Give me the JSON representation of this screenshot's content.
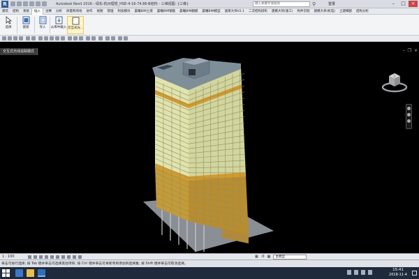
{
  "titlebar": {
    "app_logo": "R",
    "title": "Autodesk Revit 2016 - 绿东-杭州理想_HSE-4-16-74.86-B结构 - 三维视图: {三维}",
    "search_placeholder": "键入关键字或短语",
    "user": "登录"
  },
  "menu_tabs": [
    "建筑",
    "结构",
    "系统",
    "插入",
    "注释",
    "分析",
    "体量和场地",
    "协作",
    "视图",
    "管理",
    "附加模块",
    "晨曦BIM土建",
    "晨曦BIM钢筋",
    "晨曦BIM翻模",
    "晨曦BIM模型",
    "族库大师V2.1",
    "二次结构排布",
    "建模大师(施工)",
    "构件识别",
    "建模大师(机电)",
    "土建细部",
    "结构分析"
  ],
  "ribbon": {
    "buttons": [
      {
        "label": "选择"
      },
      {
        "label": "链接"
      },
      {
        "label": "导入"
      },
      {
        "label": "从库中载入"
      },
      {
        "label": "交互式光..."
      }
    ]
  },
  "viewport": {
    "tab_label": "交互式光线追踪模式",
    "tab_close": "×",
    "viewcube_face": "上"
  },
  "viewbar": {
    "scale": "1 : 100",
    "model_select": "主模型",
    "filter_count": ":0"
  },
  "statusbar": {
    "text": "单击可进行选择; 按 Tab 键并单击可选择其他项目; 按 Ctrl 键并单击可将新项目添加到选择集; 按 Shift 键并单击可取消选择。"
  },
  "taskbar": {
    "time": "15:41",
    "date": "2018-11-4"
  },
  "colors": {
    "facade_upper": "#d9dca0",
    "facade_lower": "#c9a33a",
    "roof": "#7f8f9a",
    "band": "#d49a2a"
  }
}
